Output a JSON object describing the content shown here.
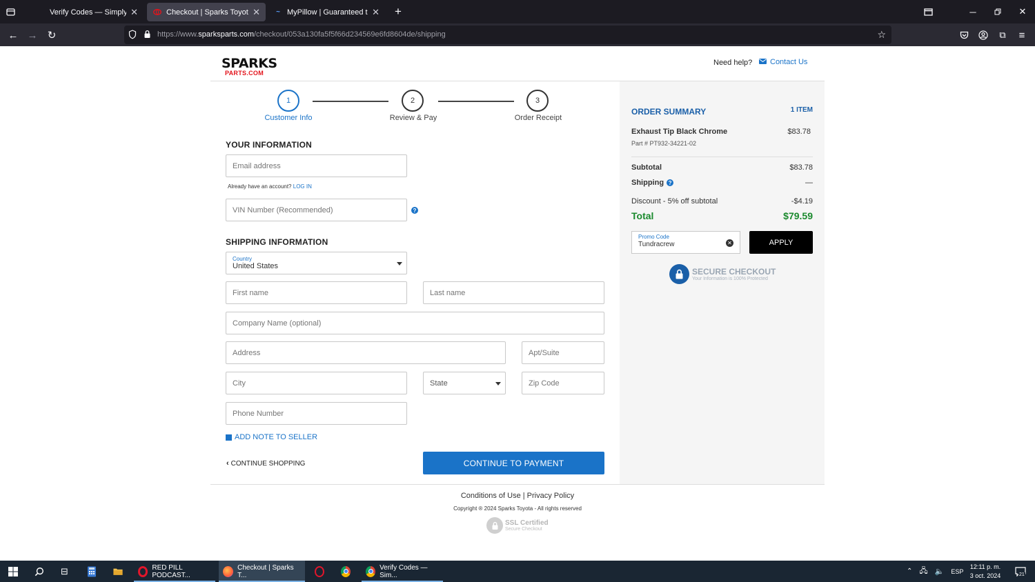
{
  "browser": {
    "tabs": [
      {
        "title": "Verify Codes — SimplyCodes",
        "active": false
      },
      {
        "title": "Checkout | Sparks Toyota",
        "active": true
      },
      {
        "title": "MyPillow | Guaranteed the Most",
        "active": false
      }
    ],
    "url_prefix": "https://www.",
    "url_domain": "sparksparts.com",
    "url_path": "/checkout/053a130fa5f5f66d234569e6fd8604de/shipping"
  },
  "header": {
    "logo_top": "SPARKS",
    "logo_bottom": "PARTS.COM",
    "need_help": "Need help?",
    "contact_us": "Contact Us"
  },
  "steps": [
    {
      "number": "1",
      "label": "Customer Info",
      "active": true
    },
    {
      "number": "2",
      "label": "Review & Pay",
      "active": false
    },
    {
      "number": "3",
      "label": "Order Receipt",
      "active": false
    }
  ],
  "your_info": {
    "title": "YOUR INFORMATION",
    "email_placeholder": "Email address",
    "account_text": "Already have an account?",
    "login_link": "LOG IN",
    "vin_placeholder": "VIN Number (Recommended)"
  },
  "shipping": {
    "title": "SHIPPING INFORMATION",
    "country_label": "Country",
    "country_value": "United States",
    "first_name": "First name",
    "last_name": "Last name",
    "company": "Company Name (optional)",
    "address": "Address",
    "apt": "Apt/Suite",
    "city": "City",
    "state": "State",
    "zip": "Zip Code",
    "phone": "Phone Number",
    "add_note": "ADD NOTE TO SELLER",
    "continue_shopping": "CONTINUE SHOPPING",
    "continue_payment": "CONTINUE TO PAYMENT"
  },
  "summary": {
    "title": "ORDER SUMMARY",
    "item_count": "1 ITEM",
    "item_name": "Exhaust Tip Black Chrome",
    "item_price": "$83.78",
    "part_number": "Part # PT932-34221-02",
    "subtotal_label": "Subtotal",
    "subtotal_value": "$83.78",
    "shipping_label": "Shipping",
    "shipping_value": "—",
    "discount_label": "Discount - 5% off subtotal",
    "discount_value": "-$4.19",
    "total_label": "Total",
    "total_value": "$79.59",
    "promo_label": "Promo Code",
    "promo_value": "Tundracrew",
    "apply": "APPLY",
    "secure_title": "SECURE CHECKOUT",
    "secure_sub": "Your Information is 100% Protected"
  },
  "footer": {
    "conditions": "Conditions of Use",
    "sep": "|",
    "privacy": "Privacy Policy",
    "copyright": "Copyright ® 2024 Sparks Toyota - All rights reserved",
    "ssl_title": "SSL Certified",
    "ssl_sub": "Secure Checkout"
  },
  "taskbar": {
    "apps": [
      {
        "label": "RED PILL PODCAST..."
      },
      {
        "label": "Checkout | Sparks T..."
      },
      {
        "label": "Verify Codes — Sim..."
      }
    ],
    "lang": "ESP",
    "time": "12:11 p. m.",
    "date": "3 oct. 2024",
    "notif_count": "21"
  },
  "colors": {
    "accent": "#1a73c8",
    "total_green": "#1b8a2e",
    "brand_red": "#e3131b"
  }
}
